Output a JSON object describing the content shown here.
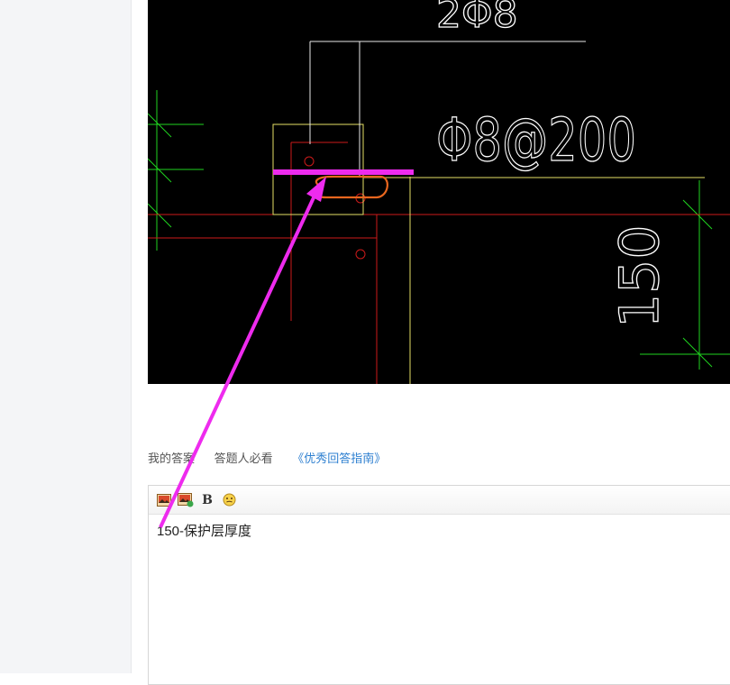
{
  "drawing": {
    "rebar_count_label": "2Φ8",
    "stirrup_label": "Φ8@200",
    "dimension_label": "150"
  },
  "answer_bar": {
    "my_answer": "我的答案",
    "must_read": "答题人必看",
    "guide_link": "《优秀回答指南》"
  },
  "editor": {
    "content": "150-保护层厚度"
  },
  "icons": {
    "insert_image": "image-icon",
    "insert_image_alt": "image-plus-icon",
    "bold": "bold-icon",
    "emoji": "emoji-icon"
  },
  "colors": {
    "annotation": "#ee2bee",
    "circle_mark": "#e8661e",
    "cad_green": "#1fd31f",
    "cad_red": "#cc1a1a",
    "cad_yellow": "#e6e066",
    "link": "#2d7fd0"
  }
}
